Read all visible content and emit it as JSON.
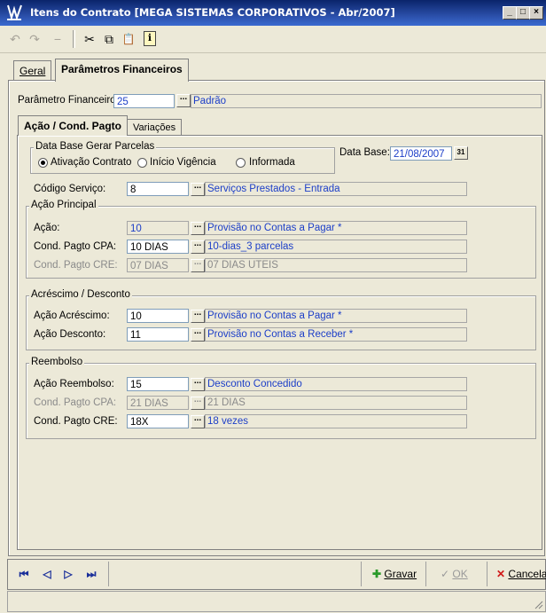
{
  "window": {
    "title": "Itens do Contrato [MEGA SISTEMAS CORPORATIVOS - Abr/2007]",
    "minimize": "_",
    "maximize": "□",
    "close": "×"
  },
  "toolbar": {
    "undo": "↶",
    "redo": "↷",
    "minus": "−",
    "cut": "✂",
    "copy": "⧉",
    "paste": "📋",
    "info": "ℹ"
  },
  "tabs": {
    "geral": "Geral",
    "parametros": "Parâmetros Financeiros"
  },
  "parametro": {
    "label": "Parâmetro Financeiro:",
    "code": "25",
    "desc": "Padrão"
  },
  "subtabs": {
    "acao": "Ação / Cond. Pagto",
    "variacoes": "Variações"
  },
  "data_base_group": {
    "title": "Data Base Gerar Parcelas",
    "options": [
      "Ativação Contrato",
      "Início Vigência",
      "Informada"
    ],
    "selected": 0,
    "label": "Data Base:",
    "value": "21/08/2007"
  },
  "codigo_servico": {
    "label": "Código Serviço:",
    "code": "8",
    "desc": "Serviços Prestados - Entrada"
  },
  "acao_principal": {
    "title": "Ação Principal",
    "acao": {
      "label": "Ação:",
      "code": "10",
      "desc": "Provisão no Contas a Pagar *"
    },
    "cpa": {
      "label": "Cond. Pagto CPA:",
      "code": "10 DIAS",
      "desc": "10-dias_3 parcelas"
    },
    "cre": {
      "label": "Cond. Pagto CRE:",
      "code": "07 DIAS",
      "desc": "07 DIAS UTEIS"
    }
  },
  "acrescimo_desconto": {
    "title": "Acréscimo / Desconto",
    "acrescimo": {
      "label": "Ação Acréscimo:",
      "code": "10",
      "desc": "Provisão no Contas a Pagar *"
    },
    "desconto": {
      "label": "Ação Desconto:",
      "code": "11",
      "desc": "Provisão no Contas a Receber *"
    }
  },
  "reembolso": {
    "title": "Reembolso",
    "acao": {
      "label": "Ação Reembolso:",
      "code": "15",
      "desc": "Desconto Concedido"
    },
    "cpa": {
      "label": "Cond. Pagto CPA:",
      "code": "21 DIAS",
      "desc": "21 DIAS"
    },
    "cre": {
      "label": "Cond. Pagto CRE:",
      "code": "18X",
      "desc": "18 vezes"
    }
  },
  "buttons": {
    "gravar": "Gravar",
    "ok": "OK",
    "cancela": "Cancela"
  },
  "nav": {
    "first": "⏮",
    "prev": "◁",
    "next": "▷",
    "last": "⏭"
  },
  "lookup_glyph": "...",
  "calendar_glyph": "31"
}
